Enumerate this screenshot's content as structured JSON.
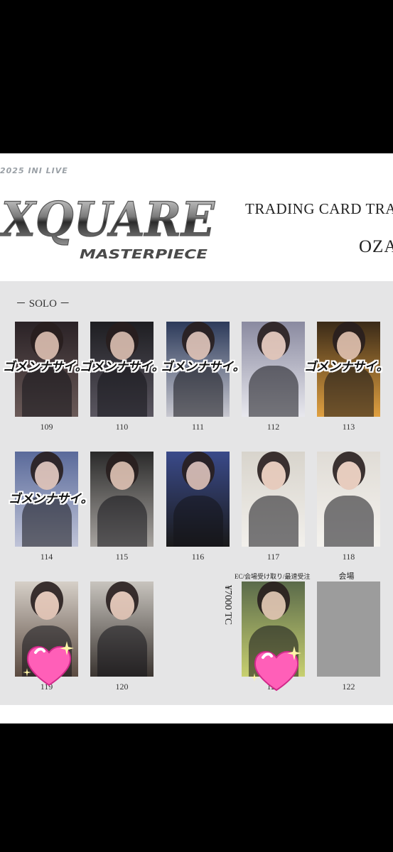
{
  "header": {
    "logo_sub": "2025 INI LIVE",
    "logo_main": "XQUARE",
    "logo_script": "MASTERPIECE",
    "title": "TRADING CARD TRADE",
    "member": "OZAKI"
  },
  "section_label": "－ SOLO －",
  "sticker_text": "ゴメンナサイ。",
  "cards": [
    {
      "number": "109"
    },
    {
      "number": "110"
    },
    {
      "number": "111"
    },
    {
      "number": "112"
    },
    {
      "number": "113"
    },
    {
      "number": "114"
    },
    {
      "number": "115"
    },
    {
      "number": "116"
    },
    {
      "number": "117"
    },
    {
      "number": "118"
    },
    {
      "number": "119"
    },
    {
      "number": "120"
    },
    {
      "number": "121"
    },
    {
      "number": "122"
    }
  ],
  "ec_label": "EC/会場受け取り/最速受注",
  "venue_label": "会場",
  "price_note": "¥7000 TC",
  "colors": {
    "background": "#000000",
    "panel": "#e5e5e6",
    "heart": "#ff5fb8"
  }
}
